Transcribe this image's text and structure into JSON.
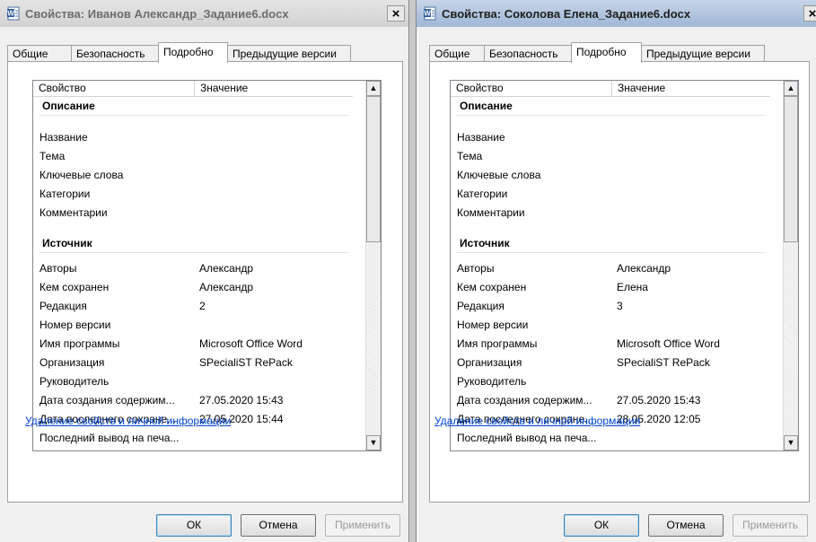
{
  "colors": {
    "link": "#0044cc",
    "window_bg": "#f0f0f0",
    "titlebar_active": "#9fb7d6"
  },
  "dialogs": [
    {
      "title": "Свойства: Иванов Александр_Задание6.docx",
      "close_label": "×",
      "tabs": [
        "Общие",
        "Безопасность",
        "Подробно",
        "Предыдущие версии"
      ],
      "active_tab": "Подробно",
      "columns": [
        "Свойство",
        "Значение"
      ],
      "groups": [
        {
          "name": "Описание",
          "rows": [
            {
              "property": "Название",
              "value": ""
            },
            {
              "property": "Тема",
              "value": ""
            },
            {
              "property": "Ключевые слова",
              "value": ""
            },
            {
              "property": "Категории",
              "value": ""
            },
            {
              "property": "Комментарии",
              "value": ""
            }
          ]
        },
        {
          "name": "Источник",
          "rows": [
            {
              "property": "Авторы",
              "value": "Александр"
            },
            {
              "property": "Кем сохранен",
              "value": "Александр"
            },
            {
              "property": "Редакция",
              "value": "2"
            },
            {
              "property": "Номер версии",
              "value": ""
            },
            {
              "property": "Имя программы",
              "value": "Microsoft Office Word"
            },
            {
              "property": "Организация",
              "value": "SPecialiST RePack"
            },
            {
              "property": "Руководитель",
              "value": ""
            },
            {
              "property": "Дата создания содержим...",
              "value": "27.05.2020 15:43"
            },
            {
              "property": "Дата последнего сохране...",
              "value": "27.05.2020 15:44"
            },
            {
              "property": "Последний вывод на печа...",
              "value": ""
            }
          ]
        }
      ],
      "link": "Удаление свойств и личной информации",
      "buttons": {
        "ok": "ОК",
        "cancel": "Отмена",
        "apply": "Применить"
      }
    },
    {
      "title": "Свойства: Соколова Елена_Задание6.docx",
      "close_label": "×",
      "tabs": [
        "Общие",
        "Безопасность",
        "Подробно",
        "Предыдущие версии"
      ],
      "active_tab": "Подробно",
      "columns": [
        "Свойство",
        "Значение"
      ],
      "groups": [
        {
          "name": "Описание",
          "rows": [
            {
              "property": "Название",
              "value": ""
            },
            {
              "property": "Тема",
              "value": ""
            },
            {
              "property": "Ключевые слова",
              "value": ""
            },
            {
              "property": "Категории",
              "value": ""
            },
            {
              "property": "Комментарии",
              "value": ""
            }
          ]
        },
        {
          "name": "Источник",
          "rows": [
            {
              "property": "Авторы",
              "value": "Александр"
            },
            {
              "property": "Кем сохранен",
              "value": "Елена"
            },
            {
              "property": "Редакция",
              "value": "3"
            },
            {
              "property": "Номер версии",
              "value": ""
            },
            {
              "property": "Имя программы",
              "value": "Microsoft Office Word"
            },
            {
              "property": "Организация",
              "value": "SPecialiST RePack"
            },
            {
              "property": "Руководитель",
              "value": ""
            },
            {
              "property": "Дата создания содержим...",
              "value": "27.05.2020 15:43"
            },
            {
              "property": "Дата последнего сохране...",
              "value": "28.05.2020 12:05"
            },
            {
              "property": "Последний вывод на печа...",
              "value": ""
            }
          ]
        }
      ],
      "link": "Удаление свойств и личной информации",
      "buttons": {
        "ok": "ОК",
        "cancel": "Отмена",
        "apply": "Применить"
      }
    }
  ]
}
